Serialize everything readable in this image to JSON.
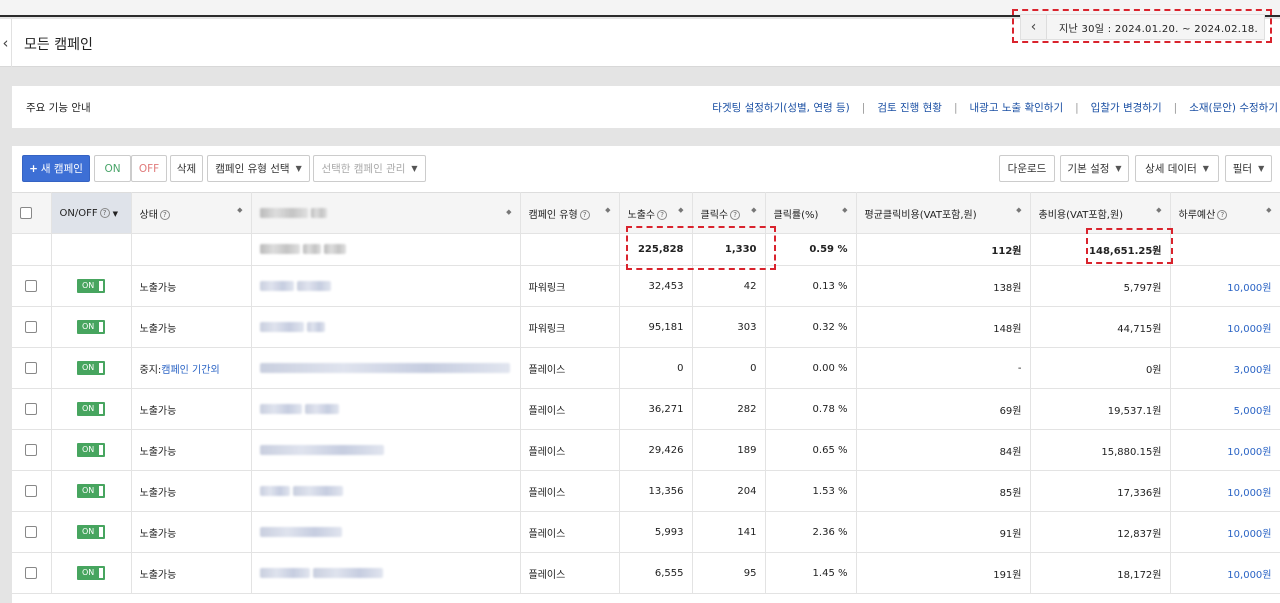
{
  "header": {
    "back_icon": "chevron-left-icon",
    "title": "모든 캠페인",
    "date_range": "지난 30일 : 2024.01.20. ~ 2024.02.18."
  },
  "guide": {
    "title": "주요 기능 안내",
    "links": [
      "타겟팅 설정하기(성별, 연령 등)",
      "검토 진행 현황",
      "내광고 노출 확인하기",
      "입찰가 변경하기",
      "소재(문안) 수정하기"
    ]
  },
  "toolbar": {
    "new_campaign": "새 캠페인",
    "on": "ON",
    "off": "OFF",
    "delete": "삭제",
    "campaign_type_select": "캠페인 유형 선택",
    "manage_selected": "선택한 캠페인 관리",
    "download": "다운로드",
    "basic_settings": "기본 설정",
    "detail_data": "상세 데이터",
    "filter": "필터"
  },
  "table": {
    "headers": {
      "onoff": "ON/OFF",
      "status": "상태",
      "campaign_type": "캠페인 유형",
      "impressions": "노출수",
      "clicks": "클릭수",
      "ctr": "클릭률(%)",
      "avg_cpc": "평균클릭비용(VAT포함,원)",
      "total_cost": "총비용(VAT포함,원)",
      "daily_budget": "하루예산"
    },
    "summary": {
      "impressions": "225,828",
      "clicks": "1,330",
      "ctr": "0.59 %",
      "avg_cpc": "112원",
      "total_cost": "148,651.25원"
    },
    "rows": [
      {
        "onoff": "ON",
        "status": "노출가능",
        "type": "파워링크",
        "impressions": "32,453",
        "clicks": "42",
        "ctr": "0.13 %",
        "avg_cpc": "138원",
        "total_cost": "5,797원",
        "budget": "10,000원"
      },
      {
        "onoff": "ON",
        "status": "노출가능",
        "type": "파워링크",
        "impressions": "95,181",
        "clicks": "303",
        "ctr": "0.32 %",
        "avg_cpc": "148원",
        "total_cost": "44,715원",
        "budget": "10,000원"
      },
      {
        "onoff": "ON",
        "status": "중지:",
        "status_link": "캠페인 기간외",
        "type": "플레이스",
        "impressions": "0",
        "clicks": "0",
        "ctr": "0.00 %",
        "avg_cpc": "-",
        "total_cost": "0원",
        "budget": "3,000원"
      },
      {
        "onoff": "ON",
        "status": "노출가능",
        "type": "플레이스",
        "impressions": "36,271",
        "clicks": "282",
        "ctr": "0.78 %",
        "avg_cpc": "69원",
        "total_cost": "19,537.1원",
        "budget": "5,000원"
      },
      {
        "onoff": "ON",
        "status": "노출가능",
        "type": "플레이스",
        "impressions": "29,426",
        "clicks": "189",
        "ctr": "0.65 %",
        "avg_cpc": "84원",
        "total_cost": "15,880.15원",
        "budget": "10,000원"
      },
      {
        "onoff": "ON",
        "status": "노출가능",
        "type": "플레이스",
        "impressions": "13,356",
        "clicks": "204",
        "ctr": "1.53 %",
        "avg_cpc": "85원",
        "total_cost": "17,336원",
        "budget": "10,000원"
      },
      {
        "onoff": "ON",
        "status": "노출가능",
        "type": "플레이스",
        "impressions": "5,993",
        "clicks": "141",
        "ctr": "2.36 %",
        "avg_cpc": "91원",
        "total_cost": "12,837원",
        "budget": "10,000원"
      },
      {
        "onoff": "ON",
        "status": "노출가능",
        "type": "플레이스",
        "impressions": "6,555",
        "clicks": "95",
        "ctr": "1.45 %",
        "avg_cpc": "191원",
        "total_cost": "18,172원",
        "budget": "10,000원"
      }
    ]
  }
}
